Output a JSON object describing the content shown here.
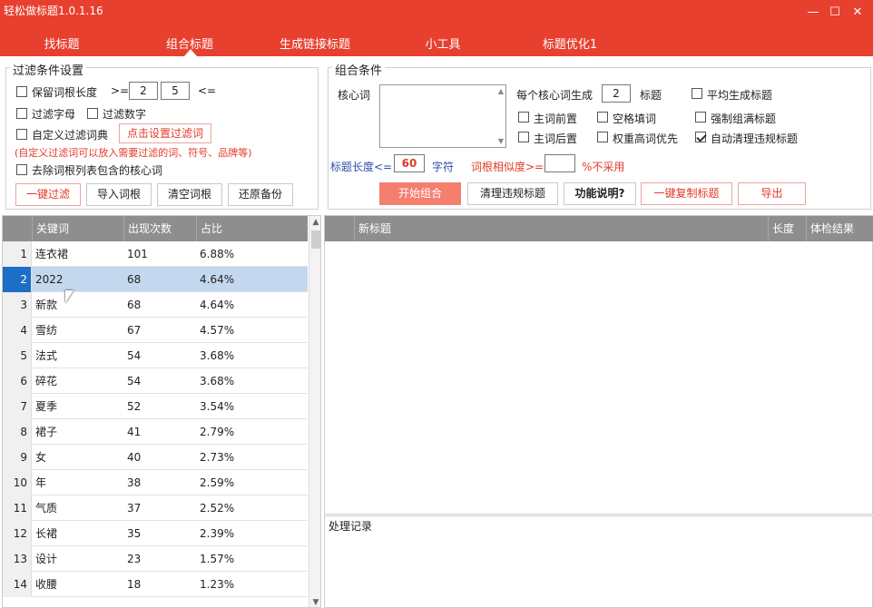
{
  "window": {
    "title": "轻松做标题1.0.1.16",
    "minimize": "—",
    "maximize": "☐",
    "close": "✕"
  },
  "nav": {
    "tabs": [
      "找标题",
      "组合标题",
      "生成链接标题",
      "小工具",
      "标题优化1"
    ],
    "active_index": 1
  },
  "filter": {
    "title": "过滤条件设置",
    "keep_root_label": "保留词根长度",
    "gte": ">=",
    "min": "2",
    "max": "5",
    "lte": "<=",
    "filter_letters": "过滤字母",
    "filter_digits": "过滤数字",
    "custom_dict": "自定义过滤词典",
    "set_filter_button": "点击设置过滤词",
    "hint": "(自定义过滤词可以放入需要过滤的词、符号、品牌等)",
    "remove_core": "去除词根列表包含的核心词",
    "buttons": [
      "一键过滤",
      "导入词根",
      "清空词根",
      "还原备份"
    ]
  },
  "combo": {
    "title": "组合条件",
    "core_label": "核心词",
    "per_core_label": "每个核心词生成",
    "per_core_value": "2",
    "titles_unit": "标题",
    "avg_label": "平均生成标题",
    "opt_front": "主词前置",
    "opt_space": "空格填词",
    "opt_force": "强制组满标题",
    "opt_back": "主词后置",
    "opt_weight": "权重高词优先",
    "opt_autoclean": "自动清理违规标题",
    "len_label": "标题长度<=",
    "len_value": "60",
    "len_unit": "字符",
    "sim_label": "词根相似度>=",
    "sim_value": "",
    "sim_note": "%不采用",
    "buttons": {
      "start": "开始组合",
      "clean": "清理违规标题",
      "help": "功能说明?",
      "copy": "一键复制标题",
      "export": "导出"
    }
  },
  "left_table": {
    "columns": [
      "关键词",
      "出现次数",
      "占比"
    ],
    "selected_row": 2,
    "rows": [
      {
        "n": "1",
        "kw": "连衣裙",
        "count": "101",
        "pct": "6.88%"
      },
      {
        "n": "2",
        "kw": "2022",
        "count": "68",
        "pct": "4.64%"
      },
      {
        "n": "3",
        "kw": "新款",
        "count": "68",
        "pct": "4.64%"
      },
      {
        "n": "4",
        "kw": "雪纺",
        "count": "67",
        "pct": "4.57%"
      },
      {
        "n": "5",
        "kw": "法式",
        "count": "54",
        "pct": "3.68%"
      },
      {
        "n": "6",
        "kw": "碎花",
        "count": "54",
        "pct": "3.68%"
      },
      {
        "n": "7",
        "kw": "夏季",
        "count": "52",
        "pct": "3.54%"
      },
      {
        "n": "8",
        "kw": "裙子",
        "count": "41",
        "pct": "2.79%"
      },
      {
        "n": "9",
        "kw": "女",
        "count": "40",
        "pct": "2.73%"
      },
      {
        "n": "10",
        "kw": "年",
        "count": "38",
        "pct": "2.59%"
      },
      {
        "n": "11",
        "kw": "气质",
        "count": "37",
        "pct": "2.52%"
      },
      {
        "n": "12",
        "kw": "长裙",
        "count": "35",
        "pct": "2.39%"
      },
      {
        "n": "13",
        "kw": "设计",
        "count": "23",
        "pct": "1.57%"
      },
      {
        "n": "14",
        "kw": "收腰",
        "count": "18",
        "pct": "1.23%"
      }
    ]
  },
  "right_table": {
    "columns": [
      "新标题",
      "长度",
      "体检结果"
    ]
  },
  "log": {
    "title": "处理记录"
  },
  "colors": {
    "accent": "#e8402f",
    "header_gray": "#8e8e8e",
    "selection": "#c3d8ee"
  }
}
